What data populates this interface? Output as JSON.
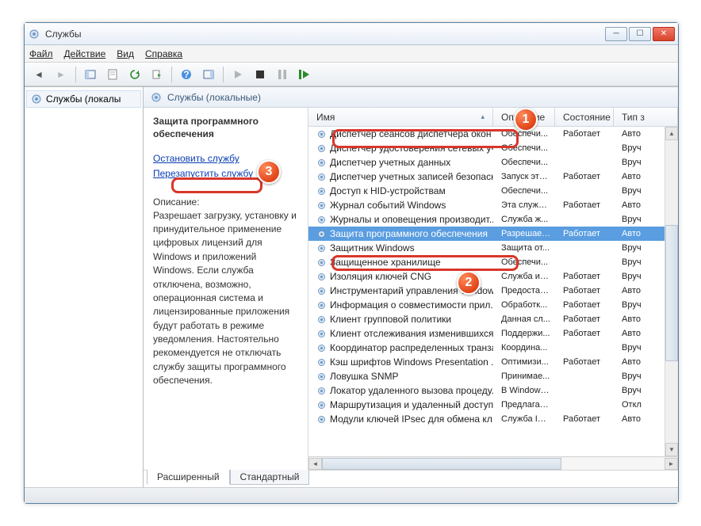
{
  "window": {
    "title": "Службы"
  },
  "menu": {
    "file": "Файл",
    "action": "Действие",
    "view": "Вид",
    "help": "Справка"
  },
  "tree": {
    "root": "Службы (локалы"
  },
  "pane": {
    "header": "Службы (локальные)"
  },
  "detail": {
    "title": "Защита программного обеспечения",
    "stop": "Остановить службу",
    "restart": "Перезапустить службу",
    "desc_label": "Описание:",
    "desc": "Разрешает загрузку, установку и принудительное применение цифровых лицензий для Windows и приложений Windows. Если служба отключена, возможно, операционная система и лицензированные приложения будут работать в режиме уведомления. Настоятельно рекомендуется не отключать службу защиты программного обеспечения."
  },
  "columns": {
    "name": "Имя",
    "desc": "Описание",
    "state": "Состояние",
    "type": "Тип з"
  },
  "services": [
    {
      "name": "Диспетчер сеансов диспетчера окон ...",
      "desc": "Обеспечи...",
      "state": "Работает",
      "type": "Авто"
    },
    {
      "name": "Диспетчер удостоверения сетевых уч...",
      "desc": "Обеспечи...",
      "state": "",
      "type": "Вруч"
    },
    {
      "name": "Диспетчер учетных данных",
      "desc": "Обеспечи...",
      "state": "",
      "type": "Вруч"
    },
    {
      "name": "Диспетчер учетных записей безопасн...",
      "desc": "Запуск это...",
      "state": "Работает",
      "type": "Авто"
    },
    {
      "name": "Доступ к HID-устройствам",
      "desc": "Обеспечи...",
      "state": "",
      "type": "Вруч"
    },
    {
      "name": "Журнал событий Windows",
      "desc": "Эта служб...",
      "state": "Работает",
      "type": "Авто"
    },
    {
      "name": "Журналы и оповещения производит...",
      "desc": "Служба ж...",
      "state": "",
      "type": "Вруч"
    },
    {
      "name": "Защита программного обеспечения",
      "desc": "Разрешает...",
      "state": "Работает",
      "type": "Авто",
      "selected": true
    },
    {
      "name": "Защитник Windows",
      "desc": "Защита от...",
      "state": "",
      "type": "Вруч"
    },
    {
      "name": "Защищенное хранилище",
      "desc": "Обеспечи...",
      "state": "",
      "type": "Вруч"
    },
    {
      "name": "Изоляция ключей CNG",
      "desc": "Служба из...",
      "state": "Работает",
      "type": "Вруч"
    },
    {
      "name": "Инструментарий управления Windows",
      "desc": "Предостав...",
      "state": "Работает",
      "type": "Авто"
    },
    {
      "name": "Информация о совместимости прил...",
      "desc": "Обработк...",
      "state": "Работает",
      "type": "Вруч"
    },
    {
      "name": "Клиент групповой политики",
      "desc": "Данная сл...",
      "state": "Работает",
      "type": "Авто"
    },
    {
      "name": "Клиент отслеживания изменившихся...",
      "desc": "Поддержи...",
      "state": "Работает",
      "type": "Авто"
    },
    {
      "name": "Координатор распределенных транза...",
      "desc": "Координа...",
      "state": "",
      "type": "Вруч"
    },
    {
      "name": "Кэш шрифтов Windows Presentation ...",
      "desc": "Оптимизи...",
      "state": "Работает",
      "type": "Авто"
    },
    {
      "name": "Ловушка SNMP",
      "desc": "Принимае...",
      "state": "",
      "type": "Вруч"
    },
    {
      "name": "Локатор удаленного вызова процеду...",
      "desc": "В Windows...",
      "state": "",
      "type": "Вруч"
    },
    {
      "name": "Маршрутизация и удаленный доступ",
      "desc": "Предлагае...",
      "state": "",
      "type": "Откл"
    },
    {
      "name": "Модули ключей IPsec для обмена кл...",
      "desc": "Служба IK...",
      "state": "Работает",
      "type": "Авто"
    }
  ],
  "tabs": {
    "extended": "Расширенный",
    "standard": "Стандартный"
  },
  "badges": {
    "b1": "1",
    "b2": "2",
    "b3": "3"
  }
}
